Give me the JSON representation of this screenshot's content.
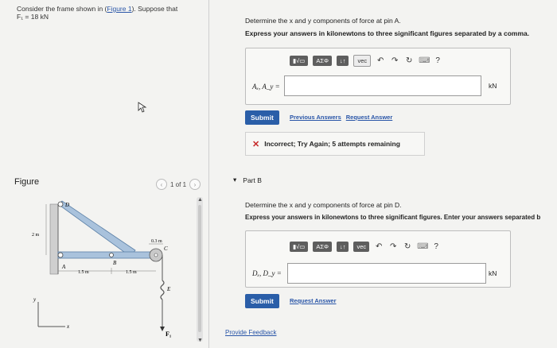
{
  "problem": {
    "text_prefix": "Consider the frame shown in (",
    "figure_link": "Figure 1",
    "text_suffix": "). Suppose that",
    "given": "F₁ = 18 kN"
  },
  "figure_panel": {
    "label": "Figure",
    "pager": "1 of 1",
    "labels": {
      "D": "D",
      "A": "A",
      "B": "B",
      "C": "C",
      "E": "E",
      "dim_2m": "2 m",
      "dim_15m_a": "1.5 m",
      "dim_15m_b": "1.5 m",
      "dim_03m": "0.3 m",
      "force": "F₁",
      "axis_y": "y",
      "axis_x": "x"
    }
  },
  "part_a": {
    "question": "Determine the x and y components of force at pin A.",
    "instruction": "Express your answers in kilonewtons to three significant figures separated by a comma.",
    "toolbar": {
      "templates": "▮√▭",
      "greek": "ΑΣΦ",
      "arrows": "↓↑",
      "vec": "vec",
      "help": "?"
    },
    "input_label": "Aₓ, A_y =",
    "input_value": "",
    "unit": "kN",
    "submit": "Submit",
    "prev_answers": "Previous Answers",
    "request_answer": "Request Answer",
    "feedback_icon": "✕",
    "feedback": "Incorrect; Try Again; 5 attempts remaining"
  },
  "part_b": {
    "arrow": "▾",
    "title": "Part B",
    "question": "Determine the x and y components of force at pin D.",
    "instruction": "Express your answers in kilonewtons to three significant figures. Enter your answers separated b",
    "toolbar": {
      "templates": "▮√▭",
      "greek": "ΑΣΦ",
      "arrows": "↓↑",
      "vec": "vec",
      "help": "?"
    },
    "input_label": "Dₓ, D_y =",
    "input_value": "",
    "unit": "kN",
    "submit": "Submit",
    "request_answer": "Request Answer"
  },
  "footer": {
    "provide_feedback": "Provide Feedback"
  },
  "colors": {
    "submit": "#2a5ea8",
    "link": "#2a56a8",
    "error": "#c62828",
    "toolbar": "#5e5e5e"
  }
}
